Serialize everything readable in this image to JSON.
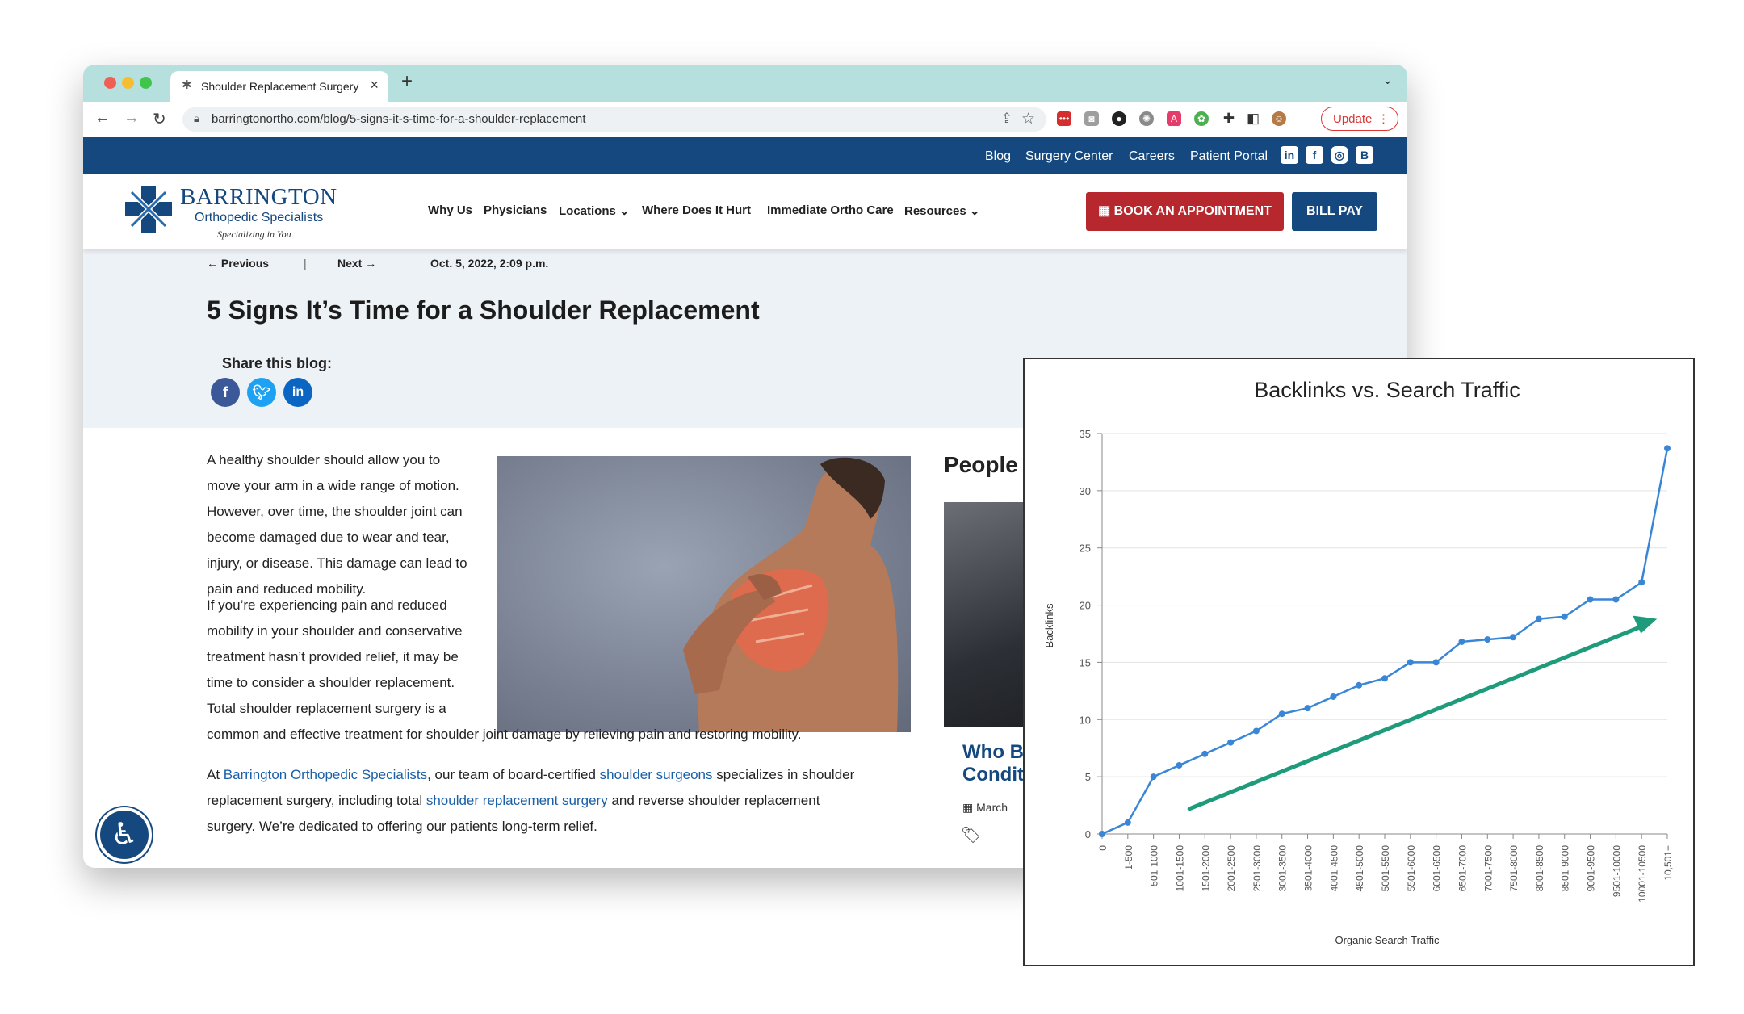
{
  "browser": {
    "tab_title": "Shoulder Replacement Surgery",
    "url": "barringtonortho.com/blog/5-signs-it-s-time-for-a-shoulder-replacement",
    "update_label": "Update",
    "icons": [
      "back-icon",
      "forward-icon",
      "reload-icon",
      "lock-icon",
      "share-icon",
      "star-icon",
      "extensions-icon",
      "sidepanel-icon",
      "profile-icon",
      "kebab-icon"
    ]
  },
  "site": {
    "topbar": {
      "links": [
        "Blog",
        "Surgery Center",
        "Careers",
        "Patient Portal"
      ],
      "social": [
        "linkedin-icon",
        "facebook-icon",
        "instagram-icon",
        "blogger-icon"
      ]
    },
    "logo": {
      "name": "BARRINGTON",
      "sub": "Orthopedic Specialists",
      "tagline": "Specializing in You"
    },
    "nav": [
      "Why Us",
      "Physicians",
      "Locations",
      "Where Does It Hurt",
      "Immediate Ortho Care",
      "Resources"
    ],
    "book_label": "BOOK AN APPOINTMENT",
    "bill_label": "BILL PAY",
    "colors": {
      "navy": "#14487e",
      "red": "#b7282e",
      "link": "#1a5fa8"
    }
  },
  "post": {
    "previous": "Previous",
    "next": "Next",
    "date": "Oct. 5, 2022, 2:09 p.m.",
    "title": "5 Signs It’s Time for a Shoulder Replacement",
    "share_label": "Share this blog:",
    "p1_lines": [
      "A healthy shoulder should allow you to",
      "move your arm in a wide range of motion.",
      "However, over time, the shoulder joint can",
      "become damaged due to wear and tear,",
      "injury, or disease. This damage can lead to",
      "pain and reduced mobility."
    ],
    "p2_lines": [
      "If you’re experiencing pain and reduced",
      "mobility in your shoulder and conservative",
      "treatment hasn’t provided relief, it may be",
      "time to consider a shoulder replacement.",
      "Total shoulder replacement surgery is a"
    ],
    "p2_last": "common and effective treatment for shoulder joint damage by relieving pain and restoring mobility.",
    "p3": {
      "a": "At ",
      "link1": "Barrington Orthopedic Specialists",
      "b": ", our team of board-certified ",
      "link2": "shoulder surgeons",
      "c": " specializes in shoulder",
      "d": "replacement surgery, including total ",
      "link3": "shoulder replacement surgery",
      "e": " and reverse shoulder replacement",
      "f": "surgery. We’re dedicated to offering our patients long-term relief."
    },
    "sidebar_heading": "People",
    "card_title_1": "Who B",
    "card_title_2": "Condit",
    "card_date": "March"
  },
  "chart_data": {
    "type": "line",
    "title": "Backlinks vs. Search Traffic",
    "xlabel": "Organic Search Traffic",
    "ylabel": "Backlinks",
    "ylim": [
      0,
      35
    ],
    "yticks": [
      0,
      5,
      10,
      15,
      20,
      25,
      30,
      35
    ],
    "grid": true,
    "categories": [
      "0",
      "1-500",
      "501-1000",
      "1001-1500",
      "1501-2000",
      "2001-2500",
      "2501-3000",
      "3001-3500",
      "3501-4000",
      "4001-4500",
      "4501-5000",
      "5001-5500",
      "5501-6000",
      "6001-6500",
      "6501-7000",
      "7001-7500",
      "7501-8000",
      "8001-8500",
      "8501-9000",
      "9001-9500",
      "9501-10000",
      "10001-10500",
      "10,501+"
    ],
    "values": [
      0,
      1,
      5,
      6,
      7,
      8,
      9,
      10.5,
      11,
      12,
      13,
      13.6,
      15,
      15,
      16.8,
      17,
      17.2,
      18.8,
      19,
      20.5,
      20.5,
      22,
      33.7
    ],
    "series_color": "#3a86d6",
    "trend_arrow_color": "#1e9b7a"
  }
}
